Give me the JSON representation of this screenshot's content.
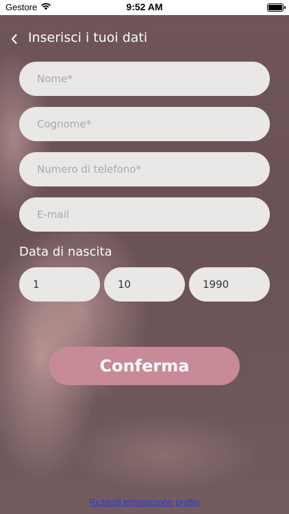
{
  "status_bar": {
    "carrier": "Gestore",
    "time": "9:52 AM",
    "icons": [
      "wifi-icon",
      "battery-icon"
    ]
  },
  "header": {
    "title": "Inserisci i tuoi dati",
    "back_icon": "chevron-left-icon"
  },
  "form": {
    "name_placeholder": "Nome*",
    "surname_placeholder": "Cognome*",
    "phone_placeholder": "Numero di telefono*",
    "email_placeholder": "E-mail",
    "dob_label": "Data di nascita",
    "dob_day": "1",
    "dob_month": "10",
    "dob_year": "1990",
    "confirm_label": "Conferma"
  },
  "footer": {
    "delete_profile_link": "Richiedi eliminazione profilo"
  },
  "colors": {
    "accent": "#c98a98",
    "field_background": "#eae7e7",
    "link": "#2a3bd6"
  }
}
